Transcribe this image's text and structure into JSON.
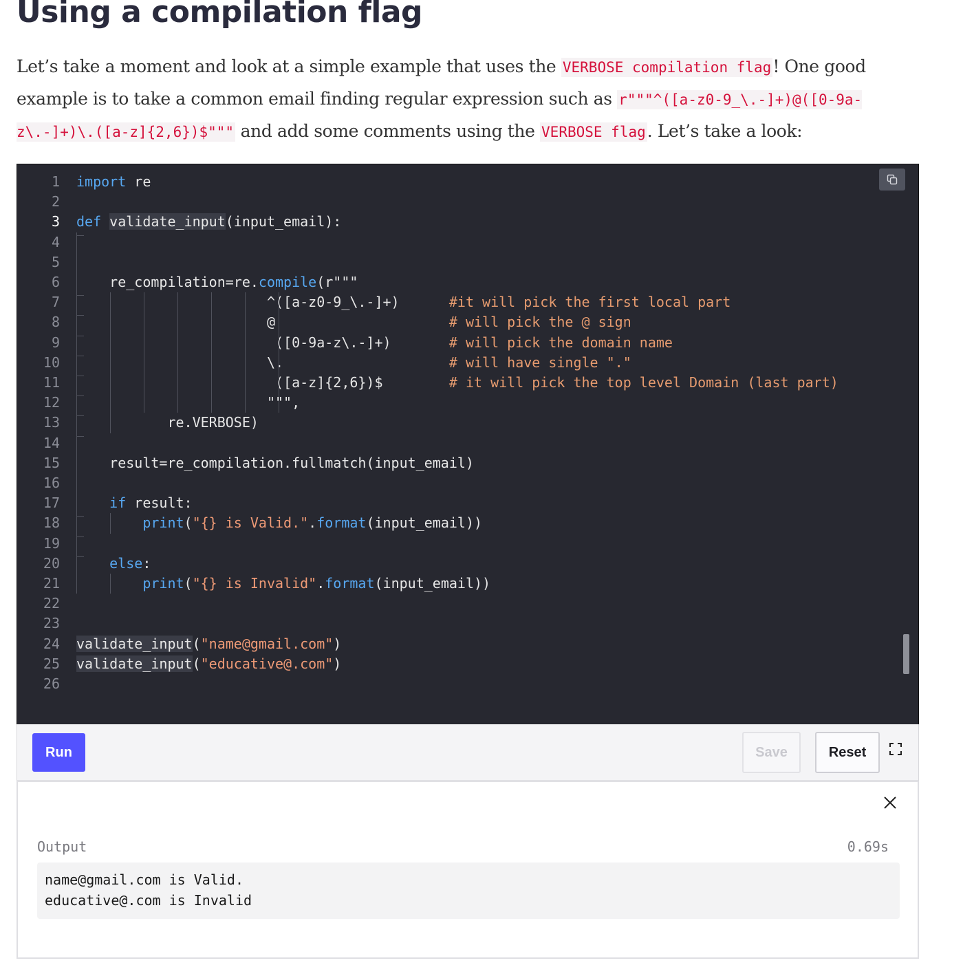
{
  "article": {
    "heading": "Using a compilation flag",
    "para": {
      "t1": "Let’s take a moment and look at a simple example that uses the ",
      "c1": "VERBOSE compilation flag",
      "t2": "! One good example is to take a common email finding regular expression such as ",
      "c2": "r\"\"\"^([a-z0-9_\\.-]+)@([0-9a-z\\.-]+)\\.([a-z]{2,6})$\"\"\"",
      "t3": " and add some comments using the ",
      "c3": "VERBOSE flag",
      "t4": ". Let’s take a look:"
    }
  },
  "editor": {
    "active_line": 3,
    "lines": [
      [
        [
          "kw",
          "import"
        ],
        [
          "",
          " re"
        ]
      ],
      [],
      [
        [
          "kw",
          "def"
        ],
        [
          "",
          " "
        ],
        [
          "hl",
          "validate_input"
        ],
        [
          "",
          "(input_email):"
        ]
      ],
      [],
      [],
      [
        [
          "",
          "    re_compilation=re."
        ],
        [
          "fn",
          "compile"
        ],
        [
          "",
          "(r\"\"\""
        ]
      ],
      [
        [
          "",
          "                       ^([a-z0-9_\\.-]+)      "
        ],
        [
          "cm",
          "#it will pick the first local part"
        ]
      ],
      [
        [
          "",
          "                       @                     "
        ],
        [
          "cm",
          "# will pick the @ sign"
        ]
      ],
      [
        [
          "",
          "                        ([0-9a-z\\.-]+)       "
        ],
        [
          "cm",
          "# will pick the domain name"
        ]
      ],
      [
        [
          "",
          "                       \\.                    "
        ],
        [
          "cm",
          "# will have single \".\""
        ]
      ],
      [
        [
          "",
          "                        ([a-z]{2,6})$        "
        ],
        [
          "cm",
          "# it will pick the top level Domain (last part)"
        ]
      ],
      [
        [
          "",
          "                       \"\"\","
        ]
      ],
      [
        [
          "",
          "           re.VERBOSE)"
        ]
      ],
      [],
      [
        [
          "",
          "    result=re_compilation.fullmatch(input_email)"
        ]
      ],
      [],
      [
        [
          "",
          "    "
        ],
        [
          "kw",
          "if"
        ],
        [
          "",
          " result:"
        ]
      ],
      [
        [
          "",
          "        "
        ],
        [
          "fn",
          "print"
        ],
        [
          "",
          "("
        ],
        [
          "str",
          "\"{} is Valid.\""
        ],
        [
          "",
          "."
        ],
        [
          "fn",
          "format"
        ],
        [
          "",
          "(input_email))"
        ]
      ],
      [],
      [
        [
          "",
          "    "
        ],
        [
          "kw",
          "else"
        ],
        [
          "",
          ":"
        ]
      ],
      [
        [
          "",
          "        "
        ],
        [
          "fn",
          "print"
        ],
        [
          "",
          "("
        ],
        [
          "str",
          "\"{} is Invalid\""
        ],
        [
          "",
          "."
        ],
        [
          "fn",
          "format"
        ],
        [
          "",
          "(input_email))"
        ]
      ],
      [],
      [],
      [
        [
          "hl",
          "validate_input"
        ],
        [
          "",
          "("
        ],
        [
          "str",
          "\"name@gmail.com\""
        ],
        [
          "",
          ")"
        ]
      ],
      [
        [
          "hl",
          "validate_input"
        ],
        [
          "",
          "("
        ],
        [
          "str",
          "\"educative@.com\""
        ],
        [
          "",
          ")"
        ]
      ],
      []
    ],
    "copy_icon": "copy-icon"
  },
  "toolbar": {
    "run_label": "Run",
    "save_label": "Save",
    "reset_label": "Reset",
    "fullscreen_icon": "fullscreen-icon"
  },
  "output": {
    "label": "Output",
    "time": "0.69s",
    "lines": [
      "name@gmail.com is Valid.",
      "educative@.com is Invalid"
    ],
    "close_icon": "close-icon"
  },
  "colors": {
    "editor_bg": "#272830",
    "keyword": "#57a7f0",
    "string": "#ee9a76",
    "comment": "#e69b6f",
    "run_button": "#5352ff",
    "inline_code": "#d5123c"
  }
}
